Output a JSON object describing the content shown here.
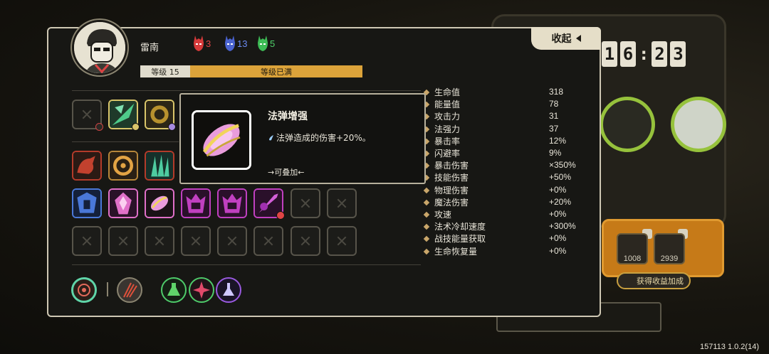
{
  "player": {
    "name": "雷南",
    "level_label": "等级 15",
    "level_status": "等级已满"
  },
  "currencies": [
    {
      "icon": "red-mask-icon",
      "count": "3",
      "color": "#e04545"
    },
    {
      "icon": "blue-mask-icon",
      "count": "13",
      "color": "#5b7be8"
    },
    {
      "icon": "green-mask-icon",
      "count": "5",
      "color": "#4fd06a"
    }
  ],
  "collapse_label": "收起",
  "stats": [
    {
      "label": "生命值",
      "value": "318"
    },
    {
      "label": "能量值",
      "value": "78"
    },
    {
      "label": "攻击力",
      "value": "31"
    },
    {
      "label": "法强力",
      "value": "37"
    },
    {
      "label": "暴击率",
      "value": "12%"
    },
    {
      "label": "闪避率",
      "value": "9%"
    },
    {
      "label": "暴击伤害",
      "value": "×350%"
    },
    {
      "label": "技能伤害",
      "value": "+50%"
    },
    {
      "label": "物理伤害",
      "value": "+0%"
    },
    {
      "label": "魔法伤害",
      "value": "+20%"
    },
    {
      "label": "攻速",
      "value": "+0%"
    },
    {
      "label": "法术冷却速度",
      "value": "+300%"
    },
    {
      "label": "战技能量获取",
      "value": "+0%"
    },
    {
      "label": "生命恢复量",
      "value": "+0%"
    }
  ],
  "tooltip": {
    "title": "法弹增强",
    "desc": "法弹造成的伤害+20%。",
    "stack": "→可叠加←"
  },
  "background": {
    "timer": [
      "1",
      "6",
      "2",
      "3"
    ],
    "box_counts": [
      "1008",
      "2939"
    ],
    "bonus_label": "获得收益加成"
  },
  "version": "157113 1.0.2(14)",
  "colors": {
    "accent_gold": "#dca33a",
    "panel_border": "#cfc8b4",
    "pink": "#e070c8"
  }
}
